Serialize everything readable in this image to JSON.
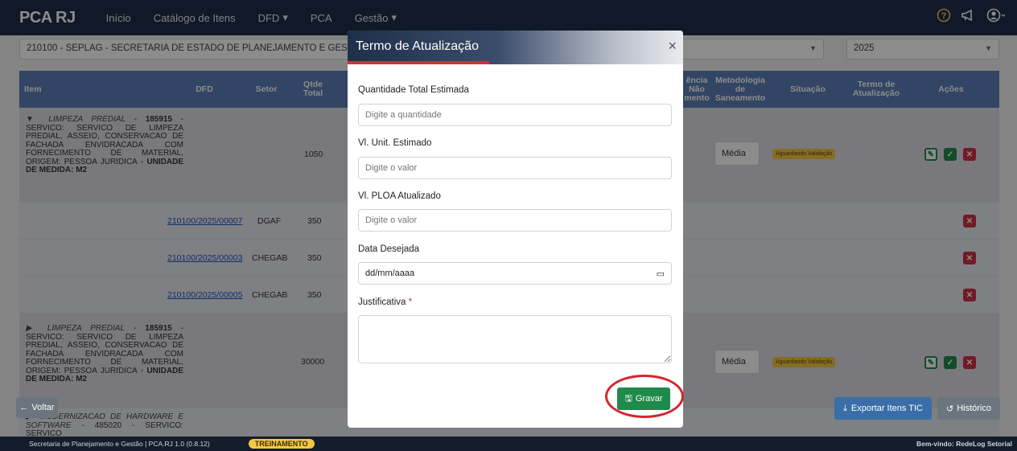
{
  "navbar": {
    "brand": "PCA RJ",
    "items": [
      "Início",
      "Catálogo de Itens",
      "DFD",
      "PCA",
      "Gestão"
    ],
    "dropdown_caret": "▾",
    "icons": [
      "help-icon",
      "megaphone-icon",
      "user-icon"
    ]
  },
  "filters": {
    "orgao": "210100 - SEPLAG - SECRETARIA DE ESTADO DE PLANEJAMENTO E GESTÃO",
    "year": "2025"
  },
  "table": {
    "headers": {
      "item": "Item",
      "dfd": "DFD",
      "setor": "Setor",
      "qtde_total": "Qtde Total",
      "ausencia_saneamento": "ência Não mento",
      "metodologia": "Metodologia de Saneamento",
      "situacao": "Situação",
      "termo": "Termo de Atualização",
      "acoes": "Ações"
    },
    "rows": [
      {
        "item_name": "▼ LIMPEZA PREDIAL",
        "item_code": "185915",
        "item_desc": "SERVICO: SERVICO DE LIMPEZA PREDIAL, ASSEIO, CONSERVACAO DE FACHADA ENVIDRACADA COM FORNECIMENTO DE MATERIAL, ORIGEM: PESSOA JURIDICA -",
        "unit": "Unidade de Medida: M2",
        "qtde": "1050",
        "metodologia": "Média",
        "situacao": "Aguardando Validação"
      },
      {
        "dfd": "210100/2025/00007",
        "setor": "DGAF",
        "qtde": "350"
      },
      {
        "dfd": "210100/2025/00003",
        "setor": "CHEGAB",
        "qtde": "350"
      },
      {
        "dfd": "210100/2025/00005",
        "setor": "CHEGAB",
        "qtde": "350"
      },
      {
        "item_name": "▶ LIMPEZA PREDIAL",
        "item_code": "185915",
        "item_desc": "SERVICO: SERVICO DE LIMPEZA PREDIAL, ASSEIO, CONSERVACAO DE FACHADA ENVIDRACADA COM FORNECIMENTO DE MATERIAL, ORIGEM: PESSOA JURIDICA -",
        "unit": "Unidade de Medida: M2",
        "qtde": "30000",
        "metodologia": "Média",
        "situacao": "Aguardando Validação"
      },
      {
        "item_name": "▶ MODERNIZACAO DE HARDWARE E SOFTWARE",
        "item_desc": "- 485020 - SERVICO: SERVICO"
      }
    ]
  },
  "buttons": {
    "back": "Voltar",
    "export": "Exportar Itens TIC",
    "history": "Histórico"
  },
  "footer": {
    "text": "Secretaria de Planejamento e Gestão | PCA.RJ 1.0 (0.8.12)",
    "badge": "TREINAMENTO",
    "welcome": "Bem-vindo: RedeLog Setorial"
  },
  "modal": {
    "title": "Termo de Atualização",
    "close": "×",
    "fields": {
      "quantidade": {
        "label": "Quantidade Total Estimada",
        "placeholder": "Digite a quantidade"
      },
      "vl_unit": {
        "label": "Vl. Unit. Estimado",
        "placeholder": "Digite o valor"
      },
      "vl_ploa": {
        "label": "Vl. PLOA Atualizado",
        "placeholder": "Digite o valor"
      },
      "data": {
        "label": "Data Desejada",
        "value": "dd/mm/aaaa"
      },
      "justificativa": {
        "label": "Justificativa",
        "required_mark": "*"
      }
    },
    "save": "Gravar"
  },
  "colors": {
    "navbar": "#1f2f4a",
    "table_header": "#5b7fb6",
    "save_green": "#1e8a4b",
    "danger_red": "#d03045",
    "highlight_red": "#d6262e"
  }
}
